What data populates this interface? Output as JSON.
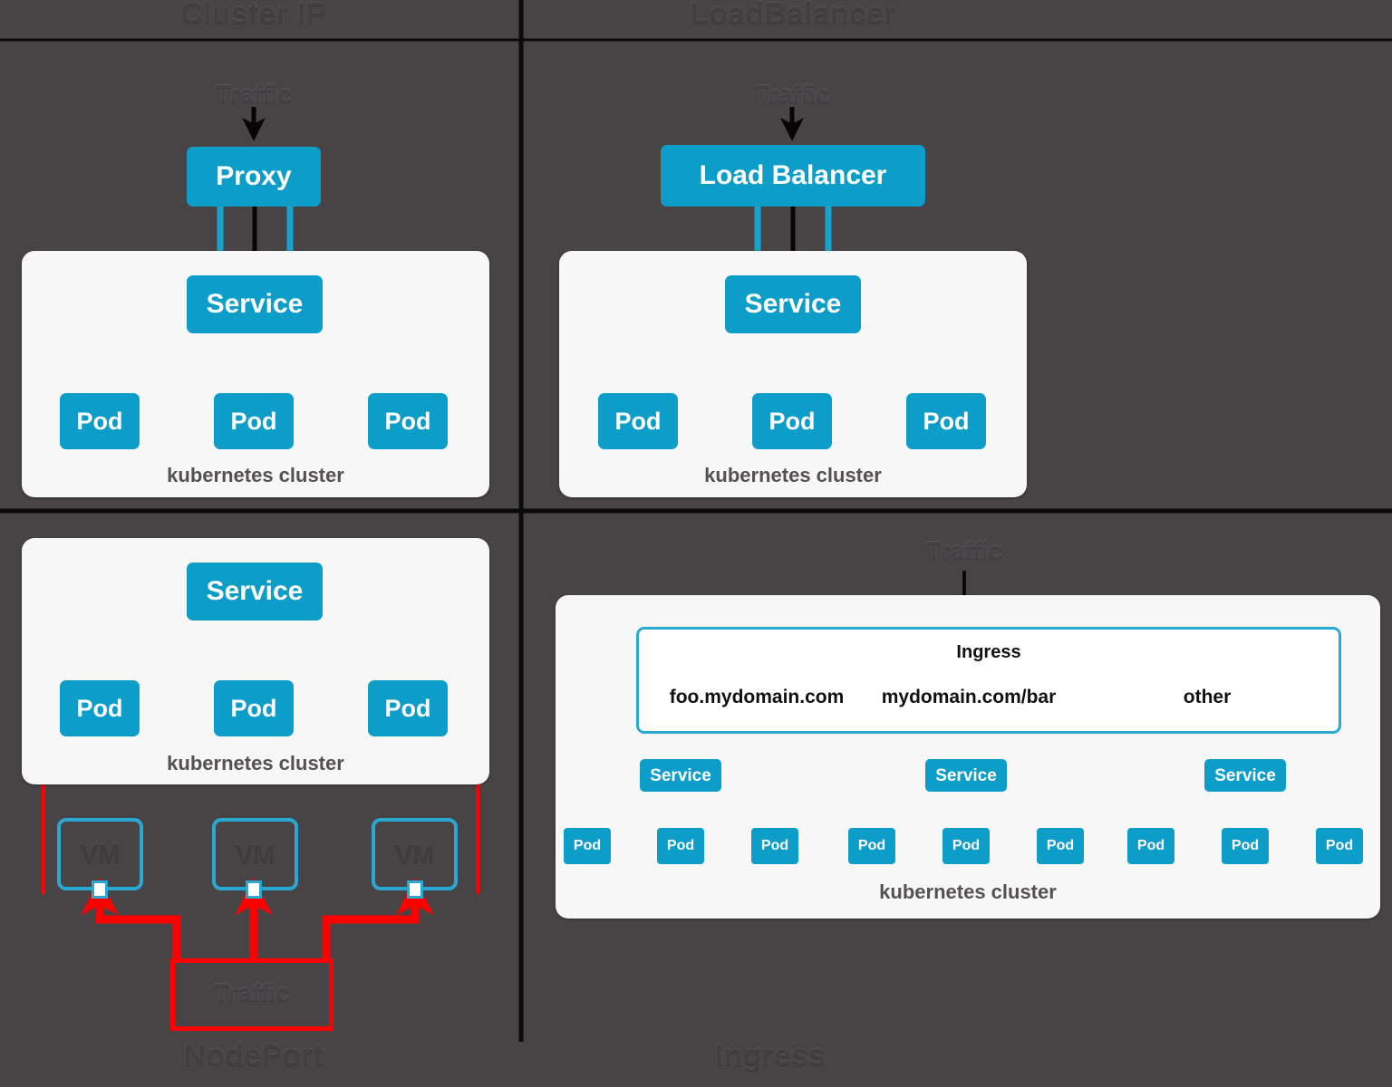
{
  "colors": {
    "background": "#484446",
    "accent_blue": "#0d9dc9",
    "vm_border": "#29a8d4",
    "red": "#fe0000",
    "cluster_bg": "#f7f7f7",
    "divider": "#0a0a0a"
  },
  "quadrants": {
    "cluster_ip": {
      "title": "Cluster IP",
      "traffic_label": "Traffic",
      "proxy_label": "Proxy",
      "service_label": "Service",
      "cluster_label": "kubernetes cluster",
      "pods": [
        "Pod",
        "Pod",
        "Pod"
      ]
    },
    "load_balancer": {
      "title": "LoadBalancer",
      "traffic_label": "Traffic",
      "lb_label": "Load Balancer",
      "service_label": "Service",
      "cluster_label": "kubernetes cluster",
      "pods": [
        "Pod",
        "Pod",
        "Pod"
      ]
    },
    "node_port": {
      "title": "NodePort",
      "traffic_label": "Traffic",
      "service_label": "Service",
      "cluster_label": "kubernetes cluster",
      "pods": [
        "Pod",
        "Pod",
        "Pod"
      ],
      "vms": [
        "VM",
        "VM",
        "VM"
      ]
    },
    "ingress": {
      "title": "Ingress",
      "traffic_label": "Traffic",
      "ingress_label": "Ingress",
      "rules": [
        "foo.mydomain.com",
        "mydomain.com/bar",
        "other"
      ],
      "cluster_label": "kubernetes cluster",
      "services": [
        "Service",
        "Service",
        "Service"
      ],
      "pods": [
        "Pod",
        "Pod",
        "Pod",
        "Pod",
        "Pod",
        "Pod",
        "Pod",
        "Pod",
        "Pod"
      ]
    }
  }
}
